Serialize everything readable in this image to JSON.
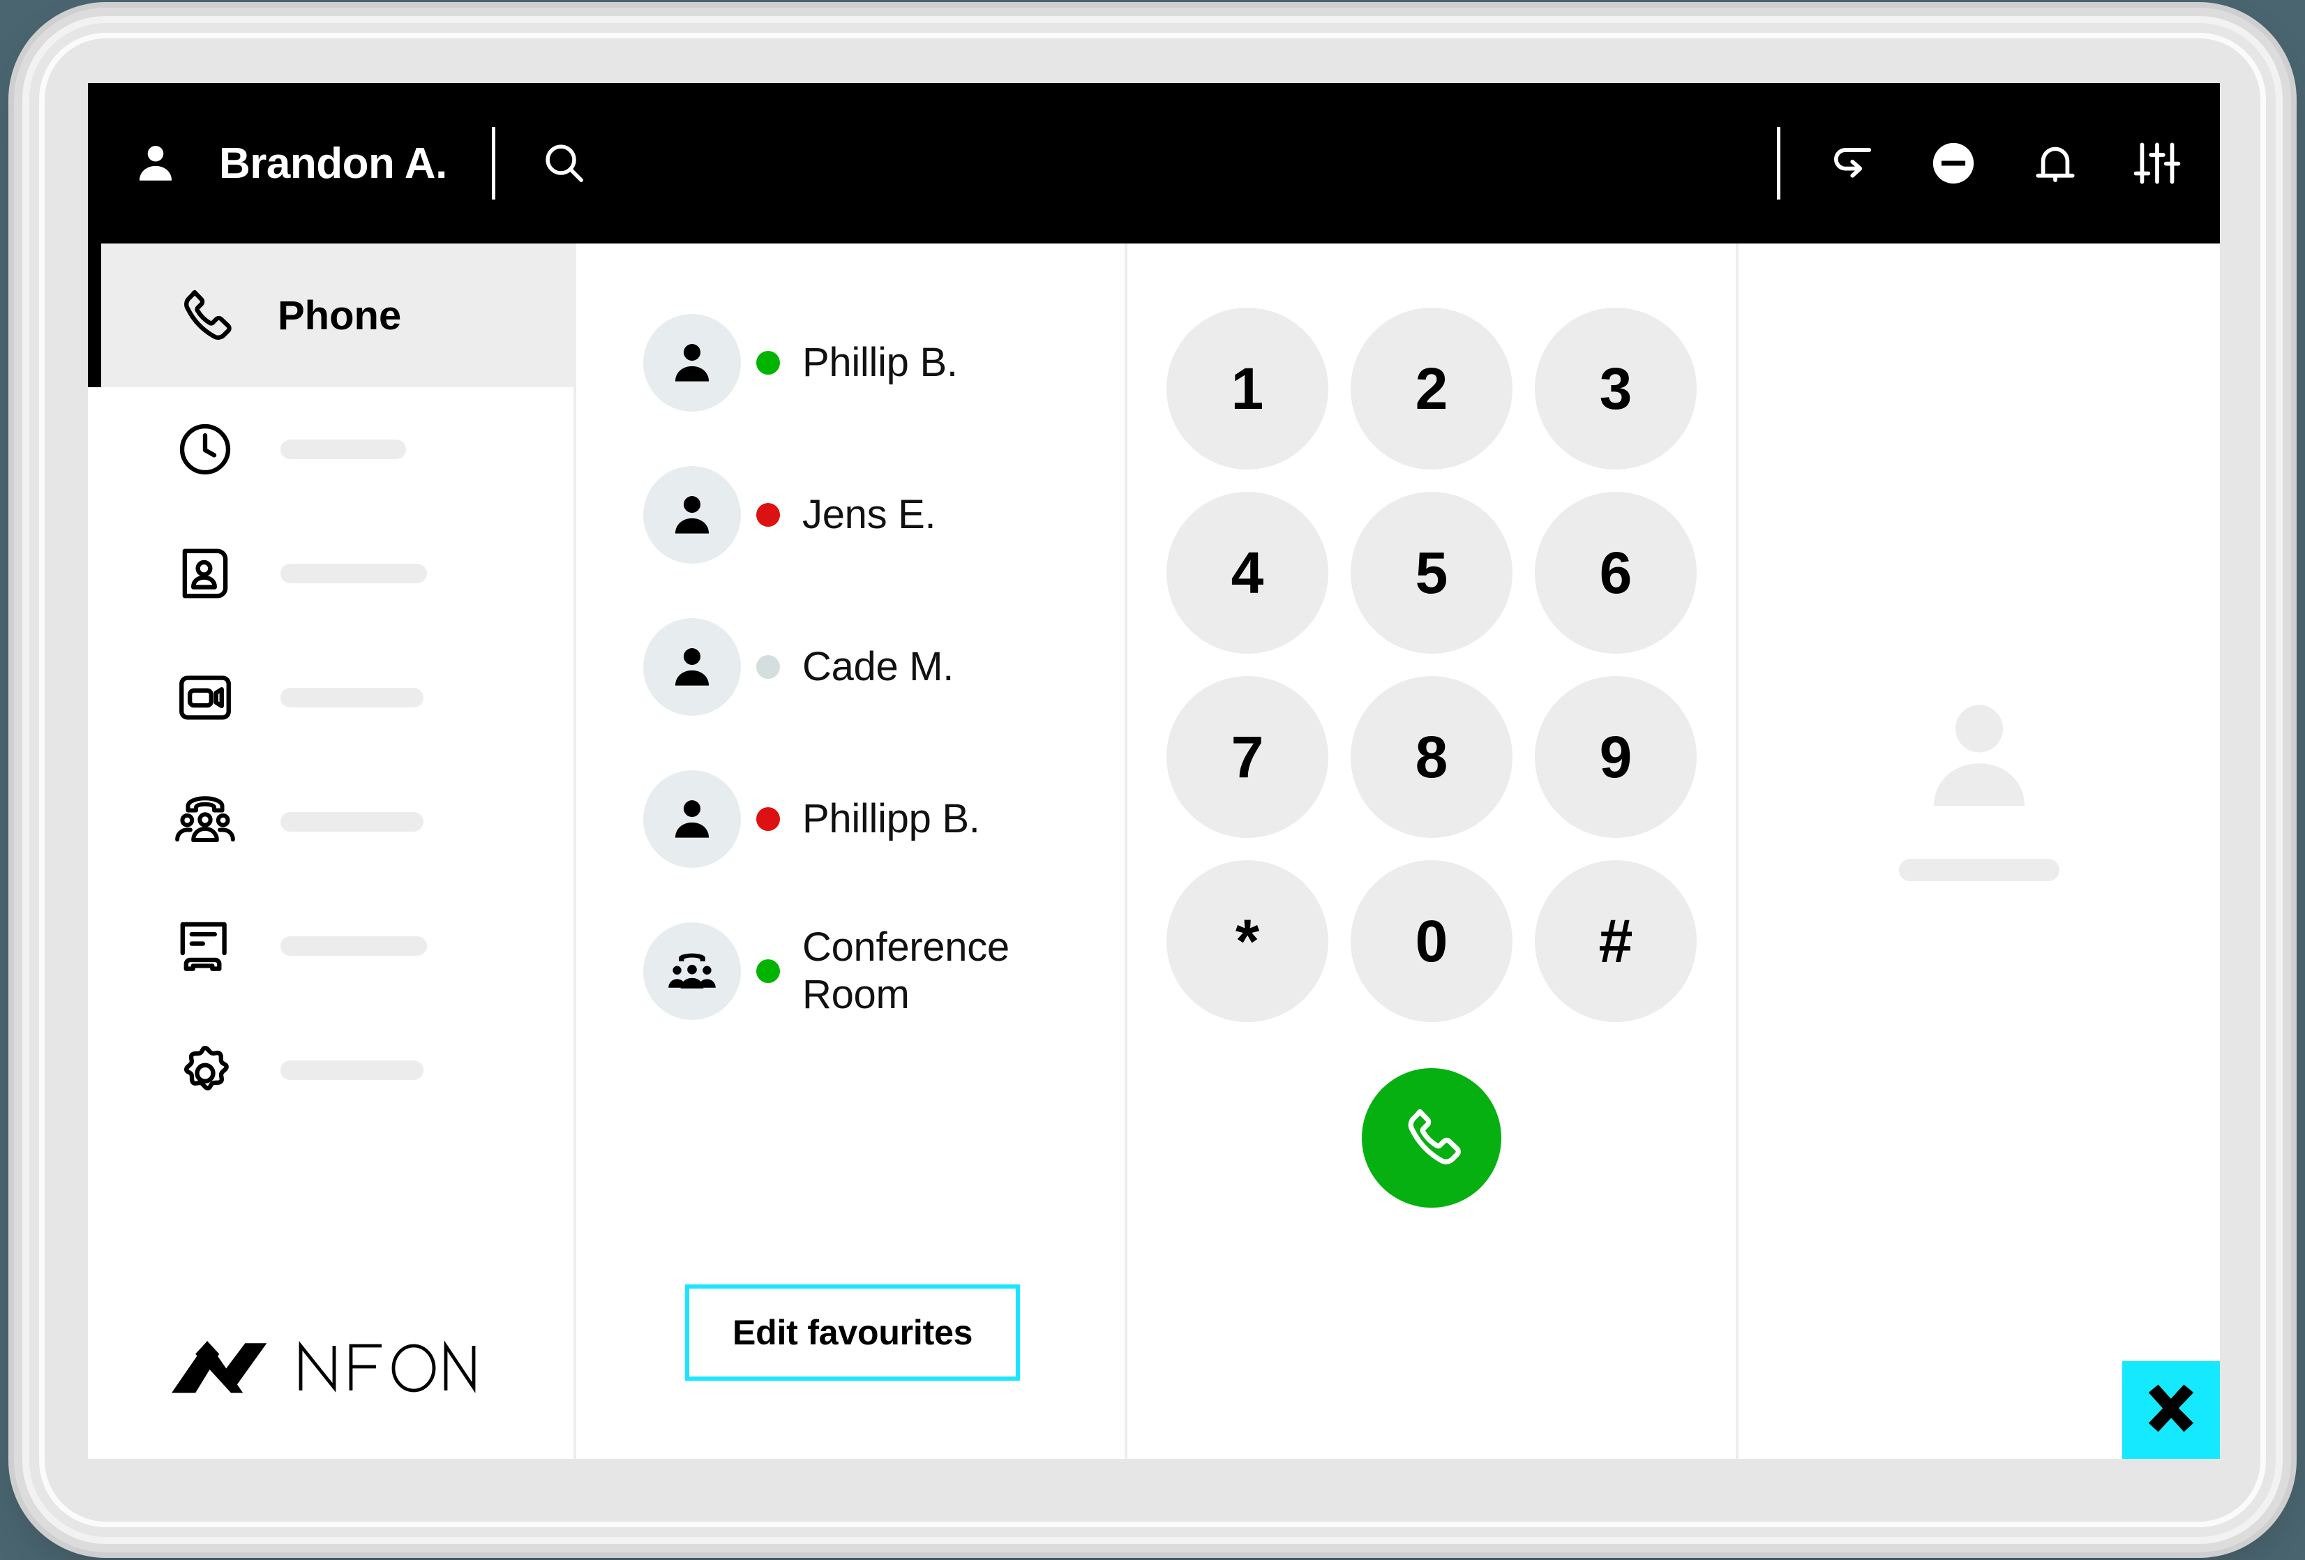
{
  "topbar": {
    "avatar_icon": "person-icon",
    "username": "Brandon A.",
    "search_icon": "search-icon",
    "actions": [
      {
        "icon": "call-forward-icon",
        "name": "call-forwarding-button"
      },
      {
        "icon": "do-not-disturb-icon",
        "name": "do-not-disturb-button"
      },
      {
        "icon": "bell-icon",
        "name": "notifications-button"
      },
      {
        "icon": "sliders-icon",
        "name": "settings-sliders-button"
      }
    ]
  },
  "sidebar": {
    "items": [
      {
        "icon": "phone-handset-icon",
        "label": "Phone",
        "active": true
      },
      {
        "icon": "clock-icon",
        "label": "",
        "active": false,
        "placeholder_width": 180
      },
      {
        "icon": "contact-card-icon",
        "label": "",
        "active": false,
        "placeholder_width": 210
      },
      {
        "icon": "video-camera-icon",
        "label": "",
        "active": false,
        "placeholder_width": 205
      },
      {
        "icon": "conference-group-icon",
        "label": "",
        "active": false,
        "placeholder_width": 205
      },
      {
        "icon": "voicemail-icon",
        "label": "",
        "active": false,
        "placeholder_width": 210
      },
      {
        "icon": "gear-icon",
        "label": "",
        "active": false,
        "placeholder_width": 205
      }
    ],
    "brand": {
      "name": "NFON",
      "mark_icon": "nfon-chevron-logo"
    }
  },
  "favourites": {
    "contacts": [
      {
        "name": "Phillip B.",
        "status": "online",
        "status_color": "#00b400",
        "avatar_icon": "person-icon"
      },
      {
        "name": "Jens E.",
        "status": "busy",
        "status_color": "#dd1111",
        "avatar_icon": "person-icon"
      },
      {
        "name": "Cade M.",
        "status": "offline",
        "status_color": "#d5dedf",
        "avatar_icon": "person-icon"
      },
      {
        "name": "Phillipp B.",
        "status": "busy",
        "status_color": "#dd1111",
        "avatar_icon": "person-icon"
      },
      {
        "name": "Conference Room",
        "status": "online",
        "status_color": "#00b400",
        "avatar_icon": "conference-group-icon"
      }
    ],
    "edit_button_label": "Edit favourites",
    "edit_button_border_color": "#1ae6ff"
  },
  "dialpad": {
    "keys": [
      "1",
      "2",
      "3",
      "4",
      "5",
      "6",
      "7",
      "8",
      "9",
      "*",
      "0",
      "#"
    ],
    "call_button": {
      "icon": "phone-handset-icon",
      "color": "#06b011"
    }
  },
  "detail": {
    "avatar_icon": "person-placeholder-icon",
    "placeholder_bar": true
  },
  "corner_badge": {
    "icon": "x-chevron-icon",
    "color": "#15e9ff"
  }
}
